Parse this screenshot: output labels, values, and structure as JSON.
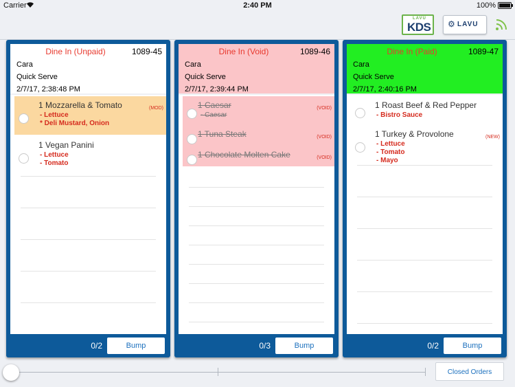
{
  "statusbar": {
    "carrier": "Carrier",
    "time": "2:40 PM",
    "battery": "100%",
    "battery_level": 1.0
  },
  "header": {
    "kds_logo_small": "LAVU",
    "kds_logo_big": "KDS",
    "lavu_button": "LAVU"
  },
  "tickets": [
    {
      "status": "Dine In (Unpaid)",
      "number": "1089-45",
      "name": "Cara",
      "service": "Quick Serve",
      "datetime": "2/7/17, 2:38:48 PM",
      "header_color": "#ffffff",
      "status_color": "#e8392e",
      "items": [
        {
          "name": "1 Mozzarella & Tomato",
          "mods": [
            "- Lettuce",
            "* Deli Mustard, Onion"
          ],
          "tag": "(MOD)",
          "highlight": "#fbd8a0"
        },
        {
          "name": "1 Vegan Panini",
          "mods": [
            "- Lettuce",
            "- Tomato"
          ],
          "tag": ""
        }
      ],
      "count": "0/2",
      "bump": "Bump"
    },
    {
      "status": "Dine In (Void)",
      "number": "1089-46",
      "name": "Cara",
      "service": "Quick Serve",
      "datetime": "2/7/17, 2:39:44 PM",
      "header_color": "#fbc5c8",
      "status_color": "#e8392e",
      "items": [
        {
          "name": "1 Caesar",
          "mods": [
            "- Caesar"
          ],
          "tag": "(VOID)",
          "highlight": "#fbc5c8"
        },
        {
          "name": "1 Tuna Steak",
          "mods": [],
          "tag": "(VOID)",
          "highlight": "#fbc5c8"
        },
        {
          "name": "1 Chocolate Molten Cake",
          "mods": [],
          "tag": "(VOID)",
          "highlight": "#fbc5c8"
        }
      ],
      "count": "0/3",
      "bump": "Bump"
    },
    {
      "status": "Dine In (Paid)",
      "number": "1089-47",
      "name": "Cara",
      "service": "Quick Serve",
      "datetime": "2/7/17, 2:40:16 PM",
      "header_color": "#22ee22",
      "status_color": "#e8392e",
      "items": [
        {
          "name": "1 Roast Beef & Red Pepper",
          "mods": [
            "- Bistro Sauce"
          ],
          "tag": ""
        },
        {
          "name": "1 Turkey & Provolone",
          "mods": [
            "- Lettuce",
            "- Tomato",
            "- Mayo"
          ],
          "tag": "(NEW)"
        }
      ],
      "count": "0/2",
      "bump": "Bump"
    }
  ],
  "footer": {
    "closed_orders": "Closed Orders"
  },
  "colors": {
    "ticket_frame": "#0d5a9a",
    "accent_blue": "#1a6fbd",
    "alert_red": "#d52b1e"
  }
}
